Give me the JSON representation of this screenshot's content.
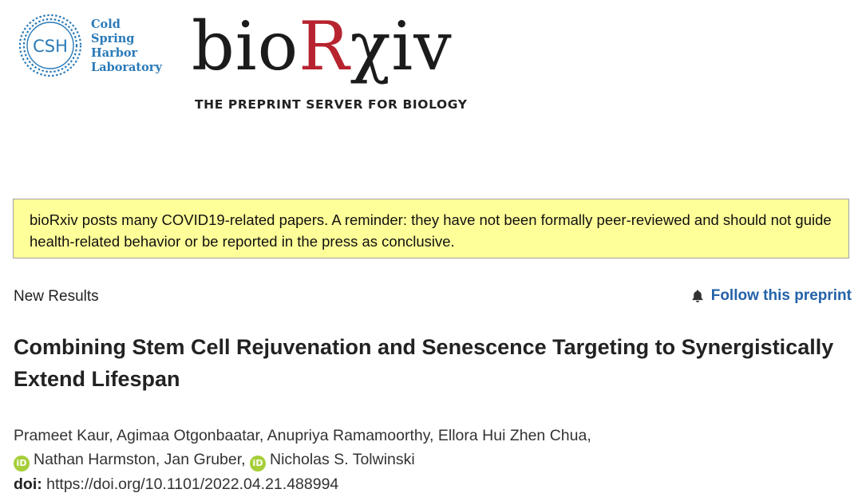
{
  "header": {
    "csh_logo": {
      "monogram": "CSH",
      "lines": [
        "Cold",
        "Spring",
        "Harbor",
        "Laboratory"
      ],
      "color": "#2a7ab8"
    },
    "biorxiv_logo": {
      "prefix": "bio",
      "r": "R",
      "chi": "χ",
      "suffix": "iv",
      "tagline": "THE PREPRINT SERVER FOR BIOLOGY",
      "accent_color": "#b7232e"
    }
  },
  "notice": {
    "text": "bioRxiv posts many COVID19-related papers. A reminder: they have not been formally peer-reviewed and should not guide health-related behavior or be reported in the press as conclusive.",
    "background": "#ffff99"
  },
  "article": {
    "section": "New Results",
    "follow_label": "Follow this preprint",
    "follow_icon": "bell-icon",
    "title": "Combining Stem Cell Rejuvenation and Senescence Targeting to Synergistically Extend Lifespan",
    "authors": [
      {
        "name": "Prameet Kaur",
        "orcid": false
      },
      {
        "name": "Agimaa Otgonbaatar",
        "orcid": false
      },
      {
        "name": "Anupriya Ramamoorthy",
        "orcid": false
      },
      {
        "name": "Ellora Hui Zhen Chua",
        "orcid": false
      },
      {
        "name": "Nathan Harmston",
        "orcid": true
      },
      {
        "name": "Jan Gruber",
        "orcid": false
      },
      {
        "name": "Nicholas S. Tolwinski",
        "orcid": true
      }
    ],
    "orcid_glyph": "iD",
    "doi_label": "doi:",
    "doi_url": "https://doi.org/10.1101/2022.04.21.488994",
    "link_color": "#2462a8"
  }
}
